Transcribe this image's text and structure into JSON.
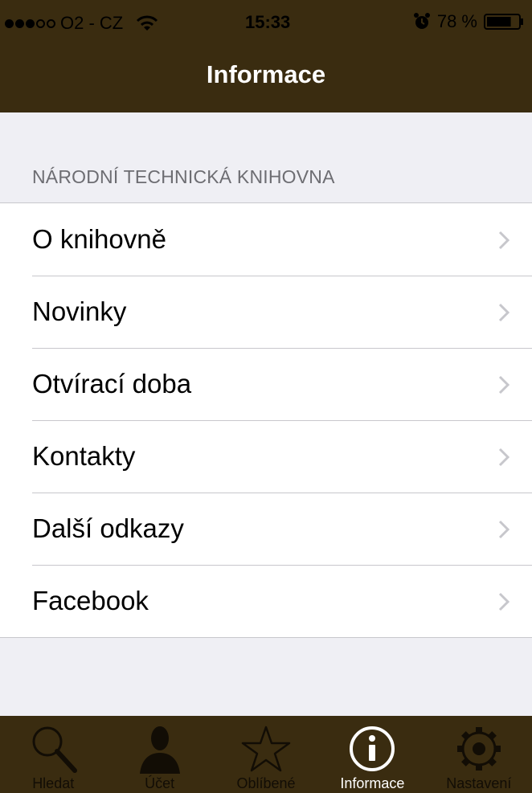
{
  "status_bar": {
    "carrier": "O2 - CZ",
    "time": "15:33",
    "battery": "78 %",
    "signal_bars_filled": 3,
    "signal_bars_total": 5,
    "battery_level": 0.78,
    "icons": [
      "signal-dots-icon",
      "wifi-icon",
      "alarm-icon",
      "battery-icon"
    ]
  },
  "nav_bar": {
    "title": "Informace"
  },
  "section": {
    "header": "NÁRODNÍ TECHNICKÁ KNIHOVNA",
    "items": [
      {
        "label": "O knihovně"
      },
      {
        "label": "Novinky"
      },
      {
        "label": "Otvírací doba"
      },
      {
        "label": "Kontakty"
      },
      {
        "label": "Další odkazy"
      },
      {
        "label": "Facebook"
      }
    ]
  },
  "tab_bar": {
    "tabs": [
      {
        "label": "Hledat",
        "icon": "search-icon"
      },
      {
        "label": "Účet",
        "icon": "person-icon"
      },
      {
        "label": "Oblíbené",
        "icon": "star-icon"
      },
      {
        "label": "Informace",
        "icon": "info-icon",
        "active": true
      },
      {
        "label": "Nastavení",
        "icon": "gear-icon"
      }
    ]
  },
  "colors": {
    "bar_background": "#3a2c10",
    "page_background": "#efeff4",
    "separator": "#c8c7cc",
    "section_header_text": "#6d6d72",
    "tab_inactive": "#120d05",
    "tab_active": "#ffffff"
  }
}
